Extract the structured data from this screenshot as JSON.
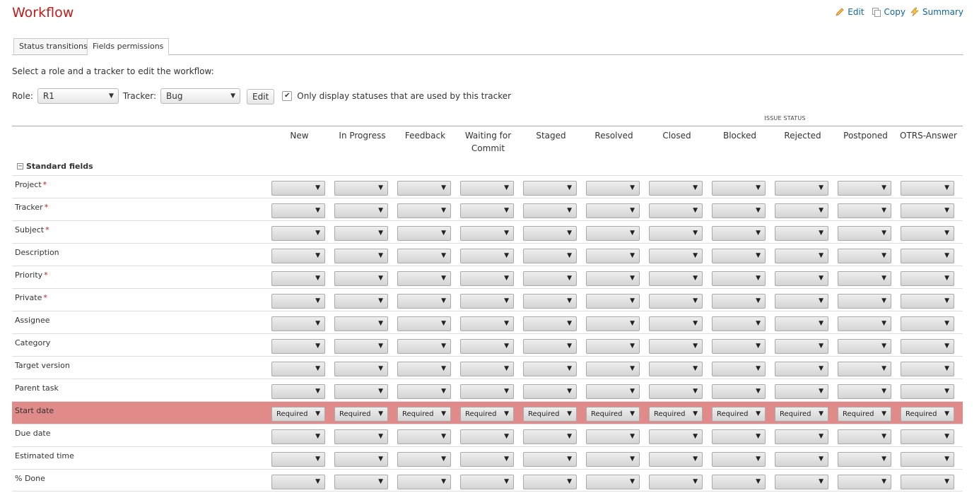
{
  "page": {
    "title": "Workflow"
  },
  "actions": {
    "edit": "Edit",
    "copy": "Copy",
    "summary": "Summary"
  },
  "tabs": [
    {
      "label": "Status transitions",
      "active": false
    },
    {
      "label": "Fields permissions",
      "active": true
    }
  ],
  "intro": "Select a role and a tracker to edit the workflow:",
  "filters": {
    "role_label": "Role:",
    "role_value": "R1",
    "tracker_label": "Tracker:",
    "tracker_value": "Bug",
    "edit_button": "Edit",
    "only_used_checked": true,
    "only_used_label": "Only display statuses that are used by this tracker"
  },
  "table": {
    "group_header": "ISSUE STATUS",
    "section_label": "Standard fields",
    "statuses": [
      "New",
      "In Progress",
      "Feedback",
      "Waiting for Commit",
      "Staged",
      "Resolved",
      "Closed",
      "Blocked",
      "Rejected",
      "Postponed",
      "OTRS-Answer"
    ],
    "fields": [
      {
        "label": "Project",
        "required": true,
        "value": ""
      },
      {
        "label": "Tracker",
        "required": true,
        "value": ""
      },
      {
        "label": "Subject",
        "required": true,
        "value": ""
      },
      {
        "label": "Description",
        "required": false,
        "value": ""
      },
      {
        "label": "Priority",
        "required": true,
        "value": ""
      },
      {
        "label": "Private",
        "required": true,
        "value": ""
      },
      {
        "label": "Assignee",
        "required": false,
        "value": ""
      },
      {
        "label": "Category",
        "required": false,
        "value": ""
      },
      {
        "label": "Target version",
        "required": false,
        "value": ""
      },
      {
        "label": "Parent task",
        "required": false,
        "value": ""
      },
      {
        "label": "Start date",
        "required": false,
        "value": "Required",
        "highlight": true
      },
      {
        "label": "Due date",
        "required": false,
        "value": ""
      },
      {
        "label": "Estimated time",
        "required": false,
        "value": ""
      },
      {
        "label": "% Done",
        "required": false,
        "value": ""
      }
    ]
  },
  "colors": {
    "title": "#c61a1a",
    "link": "#116699",
    "highlight_row": "#e08a8a"
  }
}
